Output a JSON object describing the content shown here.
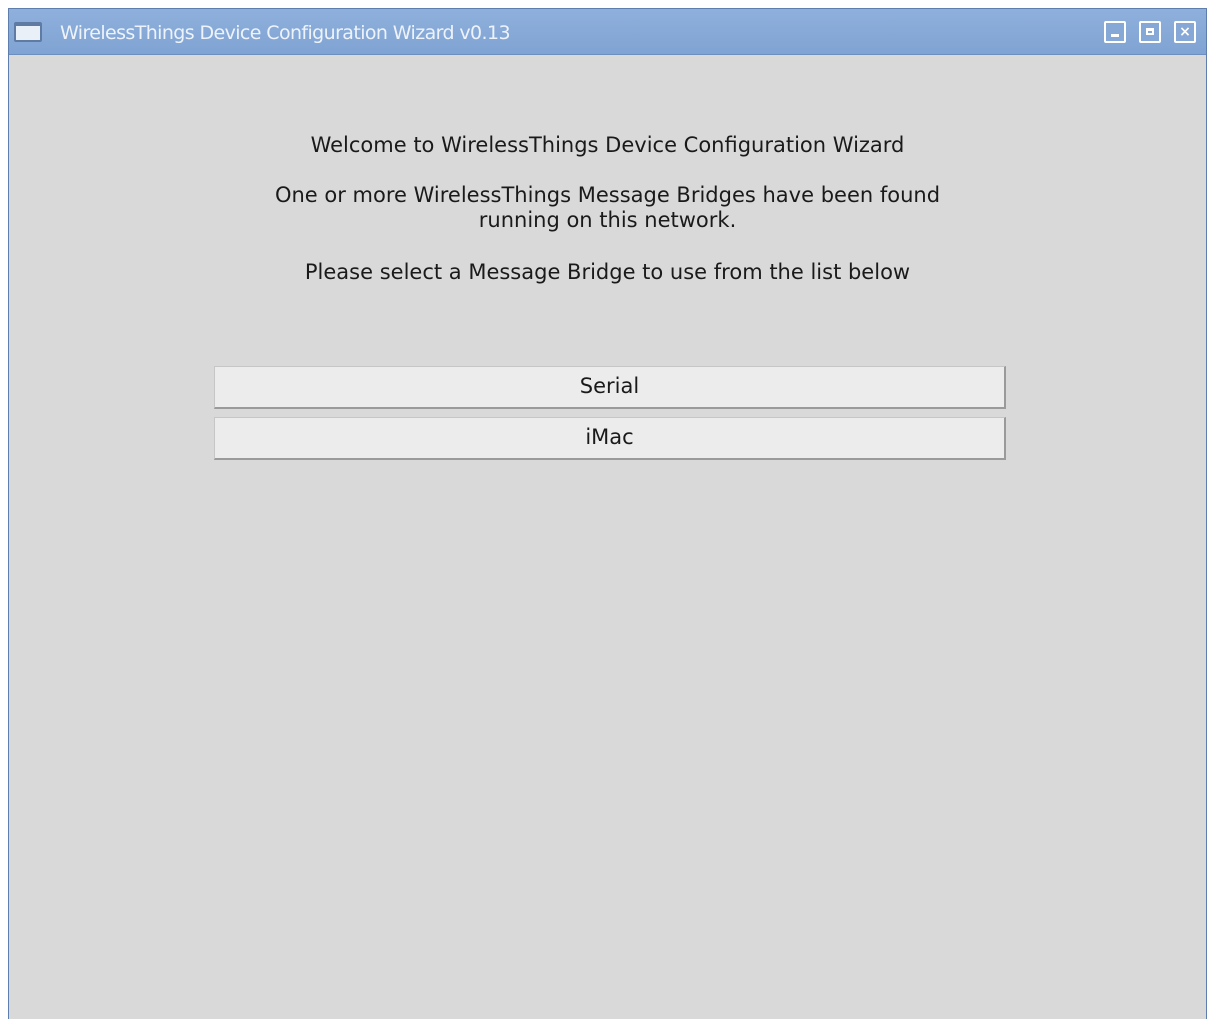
{
  "window": {
    "title": "WirelessThings Device Configuration Wizard v0.13",
    "icon": "window-icon",
    "controls": {
      "minimize_icon": "minimize-icon",
      "maximize_icon": "maximize-icon",
      "close_label": "×"
    }
  },
  "wizard": {
    "welcome": "Welcome to WirelessThings Device Configuration Wizard",
    "found_line1": "One or more WirelessThings Message Bridges have been found",
    "found_line2": "running on this network.",
    "instruction": "Please select a Message Bridge to use from the list below"
  },
  "bridges": [
    {
      "label": "Serial"
    },
    {
      "label": "iMac"
    }
  ],
  "colors": {
    "titlebar": "#7fa3d3",
    "background": "#d9d9d9",
    "button": "#ececec"
  }
}
